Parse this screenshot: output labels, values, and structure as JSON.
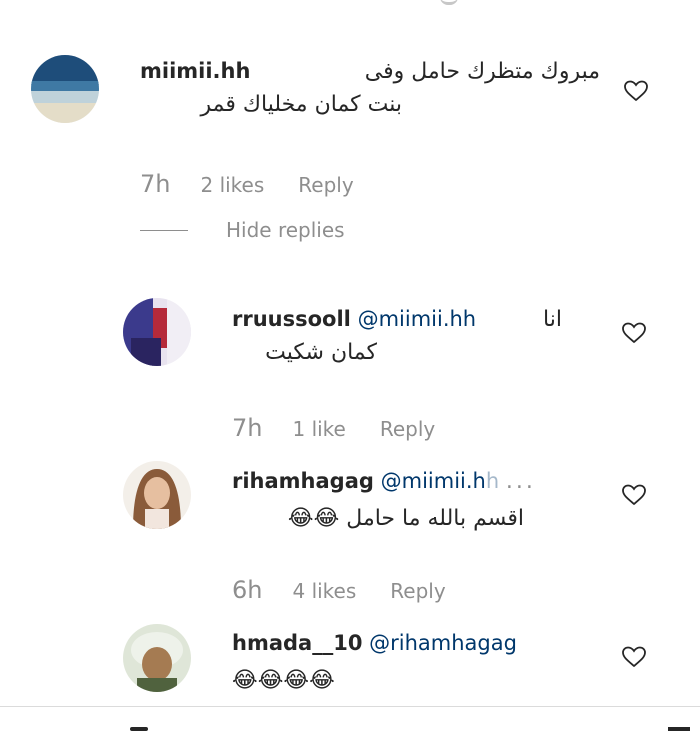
{
  "comments": [
    {
      "username": "miimii.hh",
      "text_line1": "مبروك متظرك حامل وفى",
      "text_line2": "بنت كمان مخلياك قمر",
      "time": "7h",
      "likes": "2 likes",
      "reply": "Reply"
    }
  ],
  "hide_replies": "Hide replies",
  "replies": [
    {
      "username": "rruussooll",
      "mention": "@miimii.hh",
      "text_line1": "انا",
      "text_line2": "كمان شكيت",
      "time": "7h",
      "likes": "1 like",
      "reply": "Reply"
    },
    {
      "username": "rihamhagag",
      "mention": "@miimii.h",
      "mention_fade": "h",
      "more": "...",
      "text_line2": "اقسم بالله ما حامل 😂😂",
      "time": "6h",
      "likes": "4 likes",
      "reply": "Reply"
    },
    {
      "username": "hmada__10",
      "mention": "@rihamhagag",
      "text_line2": "😂😂😂😂",
      "time": "",
      "likes": "",
      "reply": ""
    }
  ],
  "icons": {
    "like": "heart-icon",
    "more": "more-dots-icon"
  },
  "colors": {
    "username": "#262626",
    "mention": "#00376b",
    "meta": "#8e8e8e"
  }
}
